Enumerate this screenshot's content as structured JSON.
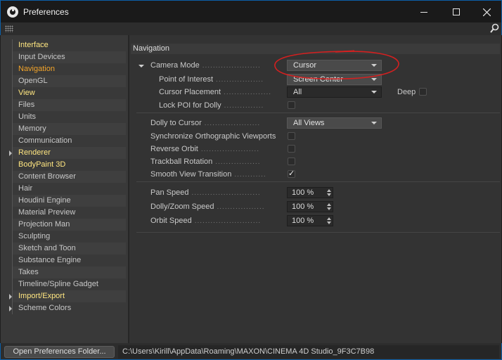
{
  "window": {
    "title": "Preferences",
    "accent_color": "#0b5fa8",
    "controls": {
      "minimize": "minimize-icon",
      "maximize": "maximize-icon",
      "close": "close-icon"
    }
  },
  "toolbar": {
    "grip_icon": "grip-icon",
    "search_icon": "search-icon"
  },
  "sidebar": {
    "items": [
      {
        "label": "Interface",
        "section": true
      },
      {
        "label": "Input Devices"
      },
      {
        "label": "Navigation",
        "active": true
      },
      {
        "label": "OpenGL"
      },
      {
        "label": "View",
        "section": true
      },
      {
        "label": "Files"
      },
      {
        "label": "Units"
      },
      {
        "label": "Memory"
      },
      {
        "label": "Communication"
      },
      {
        "label": "Renderer",
        "section": true,
        "expandable": true
      },
      {
        "label": "BodyPaint 3D",
        "section": true
      },
      {
        "label": "Content Browser"
      },
      {
        "label": "Hair"
      },
      {
        "label": "Houdini Engine"
      },
      {
        "label": "Material Preview"
      },
      {
        "label": "Projection Man"
      },
      {
        "label": "Sculpting"
      },
      {
        "label": "Sketch and Toon"
      },
      {
        "label": "Substance Engine"
      },
      {
        "label": "Takes"
      },
      {
        "label": "Timeline/Spline Gadget"
      },
      {
        "label": "Import/Export",
        "section": true,
        "expandable": true
      },
      {
        "label": "Scheme Colors",
        "expandable": true
      }
    ]
  },
  "panel": {
    "title": "Navigation",
    "camera_mode": {
      "label": "Camera Mode",
      "value": "Cursor"
    },
    "point_of_interest": {
      "label": "Point of Interest",
      "value": "Screen Center"
    },
    "cursor_placement": {
      "label": "Cursor Placement",
      "value": "All"
    },
    "deep": {
      "label": "Deep",
      "checked": false
    },
    "lock_poi": {
      "label": "Lock POI for Dolly",
      "checked": false
    },
    "dolly_to_cursor": {
      "label": "Dolly to Cursor",
      "value": "All Views"
    },
    "sync_ortho": {
      "label": "Synchronize Orthographic Viewports",
      "checked": false
    },
    "reverse_orbit": {
      "label": "Reverse Orbit",
      "checked": false
    },
    "trackball": {
      "label": "Trackball Rotation",
      "checked": false
    },
    "smooth_view": {
      "label": "Smooth View Transition",
      "checked": true,
      "mark": "✓"
    },
    "pan_speed": {
      "label": "Pan Speed",
      "value": "100 %"
    },
    "dolly_speed": {
      "label": "Dolly/Zoom Speed",
      "value": "100 %"
    },
    "orbit_speed": {
      "label": "Orbit Speed",
      "value": "100 %"
    }
  },
  "annotation_color": "#d42020",
  "footer": {
    "open_button": "Open Preferences Folder...",
    "path": "C:\\Users\\Kirill\\AppData\\Roaming\\MAXON\\CINEMA 4D Studio_9F3C7B98"
  }
}
